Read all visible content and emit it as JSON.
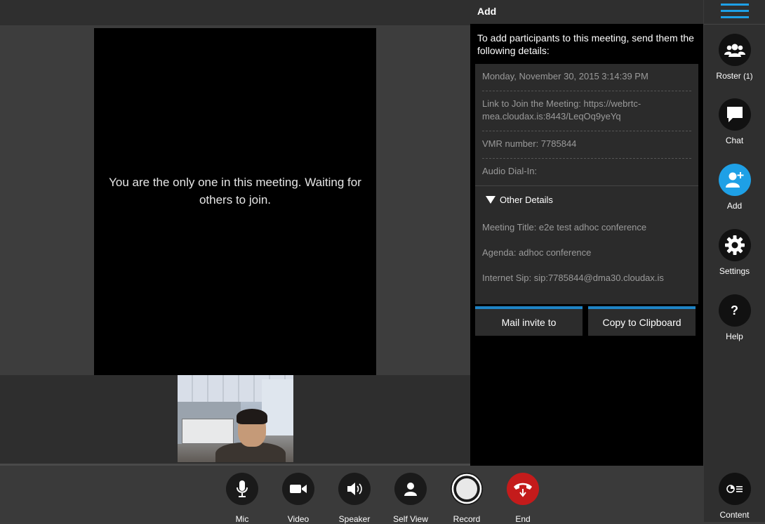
{
  "stage": {
    "waiting_message": "You are the only one in this meeting. Waiting for others to join."
  },
  "add_panel": {
    "title": "Add",
    "intro": "To add participants to this meeting, send them the following details:",
    "details": {
      "datetime": "Monday, November 30, 2015 3:14:39 PM",
      "join_link": "Link to Join the Meeting: https://webrtc-mea.cloudax.is:8443/LeqOq9yeYq",
      "vmr_number": "VMR number: 7785844",
      "audio_dial_in": "Audio Dial-In:"
    },
    "other_details": {
      "label": "Other Details",
      "meeting_title": "Meeting Title: e2e test adhoc conference",
      "agenda": "Agenda: adhoc conference",
      "internet_sip": "Internet Sip: sip:7785844@dma30.cloudax.is"
    },
    "mail_button": "Mail invite to",
    "copy_button": "Copy to Clipboard"
  },
  "sidebar": {
    "roster_label": "Roster",
    "roster_count": "(1)",
    "chat_label": "Chat",
    "add_label": "Add",
    "settings_label": "Settings",
    "help_label": "Help",
    "content_label": "Content"
  },
  "toolbar": {
    "mic": "Mic",
    "video": "Video",
    "speaker": "Speaker",
    "self_view": "Self View",
    "record": "Record",
    "end": "End"
  },
  "colors": {
    "accent": "#1ea0e6",
    "end_red": "#c41b1b"
  }
}
